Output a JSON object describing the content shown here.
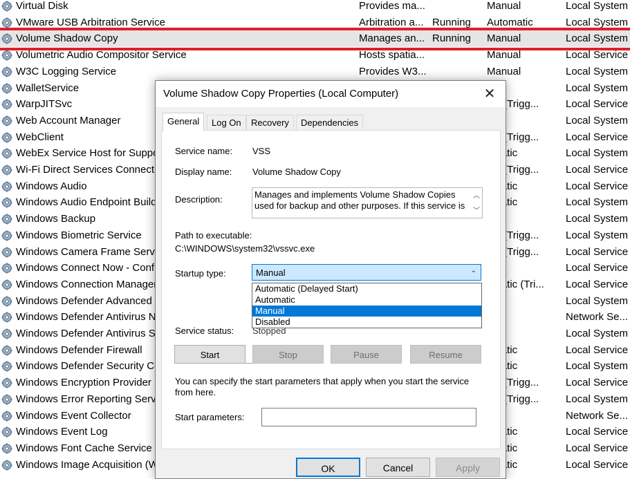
{
  "services": [
    {
      "name": "Virtual Disk",
      "desc": "Provides ma...",
      "status": "",
      "startup": "Manual",
      "logon": "Local System"
    },
    {
      "name": "VMware USB Arbitration Service",
      "desc": "Arbitration a...",
      "status": "Running",
      "startup": "Automatic",
      "logon": "Local System"
    },
    {
      "name": "Volume Shadow Copy",
      "desc": "Manages an...",
      "status": "Running",
      "startup": "Manual",
      "logon": "Local System",
      "selected": true
    },
    {
      "name": "Volumetric Audio Compositor Service",
      "desc": "Hosts spatia...",
      "status": "",
      "startup": "Manual",
      "logon": "Local Service"
    },
    {
      "name": "W3C Logging Service",
      "desc": "Provides W3...",
      "status": "",
      "startup": "Manual",
      "logon": "Local System"
    },
    {
      "name": "WalletService",
      "desc": "",
      "status": "",
      "startup": "ual",
      "logon": "Local System"
    },
    {
      "name": "WarpJITSvc",
      "desc": "",
      "status": "",
      "startup": "ual (Trigg...",
      "logon": "Local Service"
    },
    {
      "name": "Web Account Manager",
      "desc": "",
      "status": "",
      "startup": "ual",
      "logon": "Local System"
    },
    {
      "name": "WebClient",
      "desc": "",
      "status": "",
      "startup": "ual (Trigg...",
      "logon": "Local Service"
    },
    {
      "name": "WebEx Service Host for Support",
      "desc": "",
      "status": "",
      "startup": "omatic",
      "logon": "Local System"
    },
    {
      "name": "Wi-Fi Direct Services Connection",
      "desc": "",
      "status": "",
      "startup": "ual (Trigg...",
      "logon": "Local Service"
    },
    {
      "name": "Windows Audio",
      "desc": "",
      "status": "",
      "startup": "omatic",
      "logon": "Local Service"
    },
    {
      "name": "Windows Audio Endpoint Build",
      "desc": "",
      "status": "",
      "startup": "omatic",
      "logon": "Local System"
    },
    {
      "name": "Windows Backup",
      "desc": "",
      "status": "",
      "startup": "ual",
      "logon": "Local System"
    },
    {
      "name": "Windows Biometric Service",
      "desc": "",
      "status": "",
      "startup": "ual (Trigg...",
      "logon": "Local System"
    },
    {
      "name": "Windows Camera Frame Server",
      "desc": "",
      "status": "",
      "startup": "ual (Trigg...",
      "logon": "Local Service"
    },
    {
      "name": "Windows Connect Now - Config",
      "desc": "",
      "status": "",
      "startup": "ual",
      "logon": "Local Service"
    },
    {
      "name": "Windows Connection Manager",
      "desc": "",
      "status": "",
      "startup": "omatic (Tri...",
      "logon": "Local Service"
    },
    {
      "name": "Windows Defender Advanced T",
      "desc": "",
      "status": "",
      "startup": "ual",
      "logon": "Local System"
    },
    {
      "name": "Windows Defender Antivirus N",
      "desc": "",
      "status": "",
      "startup": "ual",
      "logon": "Network Se..."
    },
    {
      "name": "Windows Defender Antivirus Se",
      "desc": "",
      "status": "",
      "startup": "ual",
      "logon": "Local System"
    },
    {
      "name": "Windows Defender Firewall",
      "desc": "",
      "status": "",
      "startup": "omatic",
      "logon": "Local Service"
    },
    {
      "name": "Windows Defender Security Cer",
      "desc": "",
      "status": "",
      "startup": "omatic",
      "logon": "Local System"
    },
    {
      "name": "Windows Encryption Provider H",
      "desc": "",
      "status": "",
      "startup": "ual (Trigg...",
      "logon": "Local Service"
    },
    {
      "name": "Windows Error Reporting Servic",
      "desc": "",
      "status": "",
      "startup": "ual (Trigg...",
      "logon": "Local System"
    },
    {
      "name": "Windows Event Collector",
      "desc": "",
      "status": "",
      "startup": "ual",
      "logon": "Network Se..."
    },
    {
      "name": "Windows Event Log",
      "desc": "",
      "status": "",
      "startup": "omatic",
      "logon": "Local Service"
    },
    {
      "name": "Windows Font Cache Service",
      "desc": "",
      "status": "",
      "startup": "omatic",
      "logon": "Local Service"
    },
    {
      "name": "Windows Image Acquisition (W",
      "desc": "",
      "status": "",
      "startup": "omatic",
      "logon": "Local Service"
    }
  ],
  "highlight_color": "#e0202a",
  "dialog": {
    "title": "Volume Shadow Copy Properties (Local Computer)",
    "close_icon": "close-icon",
    "tabs": [
      "General",
      "Log On",
      "Recovery",
      "Dependencies"
    ],
    "service_name_label": "Service name:",
    "service_name": "VSS",
    "display_name_label": "Display name:",
    "display_name": "Volume Shadow Copy",
    "description_label": "Description:",
    "description": "Manages and implements Volume Shadow Copies used for backup and other purposes. If this service is",
    "path_label": "Path to executable:",
    "path": "C:\\WINDOWS\\system32\\vssvc.exe",
    "startup_label": "Startup type:",
    "startup_value": "Manual",
    "startup_options": [
      "Automatic (Delayed Start)",
      "Automatic",
      "Manual",
      "Disabled"
    ],
    "service_status_label": "Service status:",
    "service_status": "Stopped",
    "buttons": {
      "start": "Start",
      "stop": "Stop",
      "pause": "Pause",
      "resume": "Resume"
    },
    "params_note": "You can specify the start parameters that apply when you start the service from here.",
    "params_label": "Start parameters:",
    "params_value": "",
    "ok": "OK",
    "cancel": "Cancel",
    "apply": "Apply",
    "accent": "#0078d7"
  }
}
